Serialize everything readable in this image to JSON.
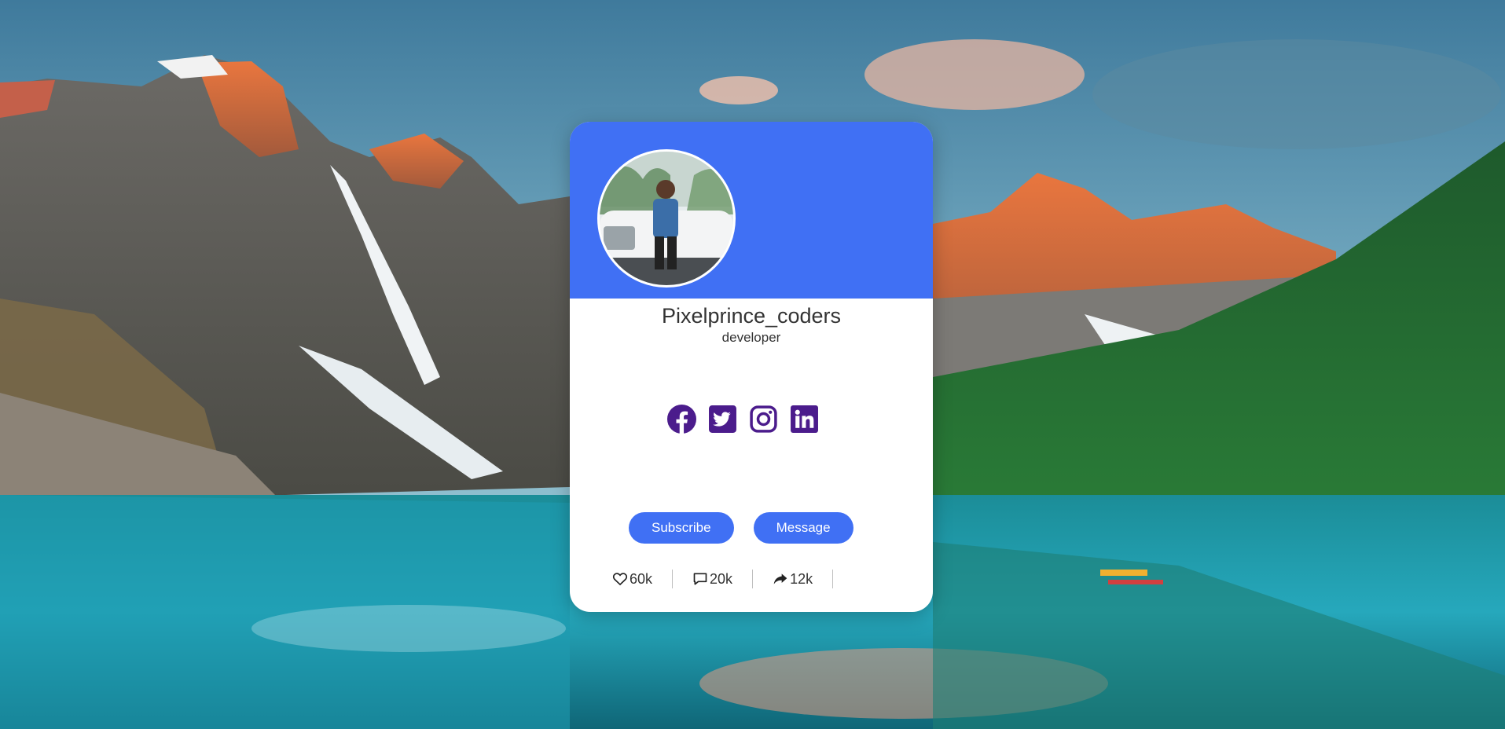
{
  "profile": {
    "username": "Pixelprince_coders",
    "role": "developer"
  },
  "social_links": [
    {
      "icon": "facebook-icon"
    },
    {
      "icon": "twitter-icon"
    },
    {
      "icon": "instagram-icon"
    },
    {
      "icon": "linkedin-icon"
    }
  ],
  "buttons": {
    "subscribe": "Subscribe",
    "message": "Message"
  },
  "stats": {
    "likes": "60k",
    "comments": "20k",
    "shares": "12k"
  },
  "colors": {
    "accent": "#4070f4",
    "social_icon": "#4b1c8c",
    "card_bg": "#ffffff"
  }
}
